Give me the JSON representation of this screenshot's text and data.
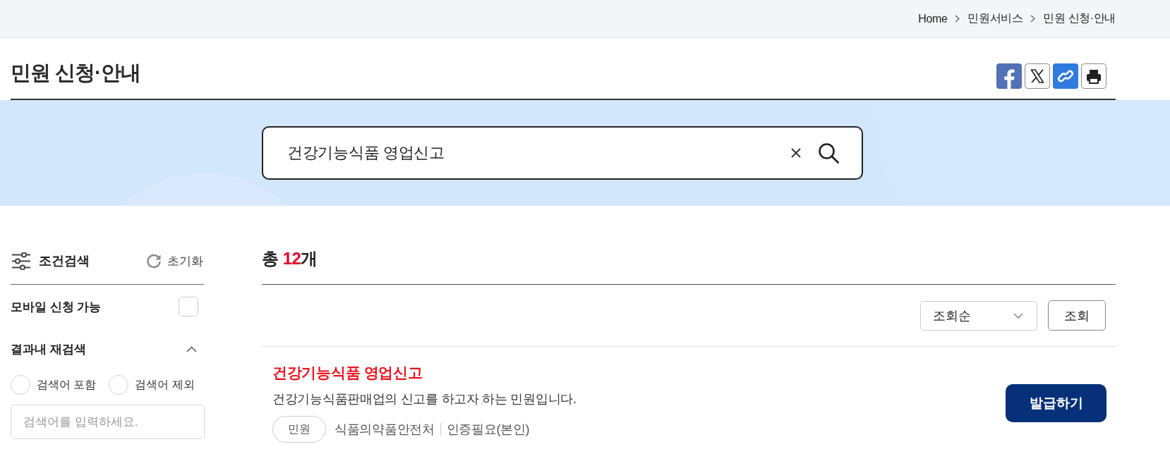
{
  "breadcrumb": [
    {
      "label": "Home"
    },
    {
      "label": "민원서비스"
    },
    {
      "label": "민원 신청·안내"
    }
  ],
  "page_title": "민원 신청·안내",
  "share_buttons": [
    {
      "kind": "facebook"
    },
    {
      "kind": "x"
    },
    {
      "kind": "link"
    },
    {
      "kind": "print"
    }
  ],
  "search": {
    "value": "건강기능식품 영업신고"
  },
  "filter_panel": {
    "title": "조건검색",
    "reset": "초기화",
    "mobile_option": {
      "label": "모바일 신청 가능",
      "checked": false
    },
    "refine": {
      "title": "결과내 재검색",
      "expanded": true,
      "options": [
        {
          "label": "검색어 포함",
          "selected": false
        },
        {
          "label": "검색어 제외",
          "selected": false
        }
      ],
      "placeholder": "검색어를 입력하세요."
    }
  },
  "results": {
    "total_label": "총",
    "count": "12",
    "unit": "개",
    "sort": {
      "value": "조회순"
    },
    "search_button": "조회",
    "items": [
      {
        "title": "건강기능식품 영업신고",
        "description": "건강기능식품판매업의 신고를 하고자 하는 민원입니다.",
        "tag": "민원",
        "agency": "식품의약품안전처",
        "auth": "인증필요(본인)",
        "action": "발급하기"
      }
    ]
  }
}
